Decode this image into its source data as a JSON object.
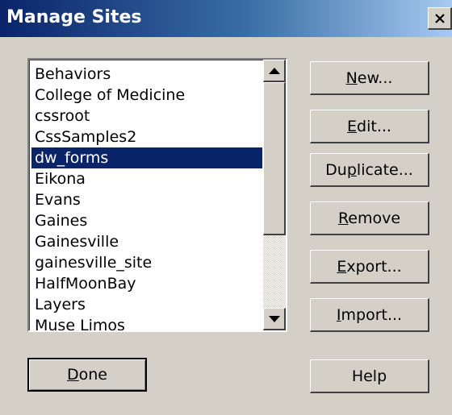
{
  "window": {
    "title": "Manage Sites"
  },
  "sites_list": {
    "items": [
      "Behaviors",
      "College of Medicine",
      "cssroot",
      "CssSamples2",
      "dw_forms",
      "Eikona",
      "Evans",
      "Gaines",
      "Gainesville",
      "gainesville_site",
      "HalfMoonBay",
      "Layers",
      "Muse Limos"
    ],
    "selected_item": "dw_forms"
  },
  "buttons": {
    "new": {
      "pre": "",
      "mnemonic": "N",
      "post": "ew..."
    },
    "edit": {
      "pre": "",
      "mnemonic": "E",
      "post": "dit..."
    },
    "duplicate": {
      "pre": "Du",
      "mnemonic": "p",
      "post": "licate..."
    },
    "remove": {
      "pre": "",
      "mnemonic": "R",
      "post": "emove"
    },
    "export": {
      "pre": "",
      "mnemonic": "E",
      "post": "xport..."
    },
    "import": {
      "pre": "",
      "mnemonic": "I",
      "post": "mport..."
    },
    "done": {
      "pre": "",
      "mnemonic": "D",
      "post": "one"
    },
    "help": {
      "label": "Help"
    }
  },
  "colors": {
    "title_bar_start": "#0a246a",
    "title_bar_end": "#a6caf0",
    "dialog_face": "#d4d0c8",
    "selection": "#0a246a"
  },
  "icons": {
    "close": "close-x-icon",
    "scroll_up": "arrow-up-icon",
    "scroll_down": "arrow-down-icon"
  }
}
